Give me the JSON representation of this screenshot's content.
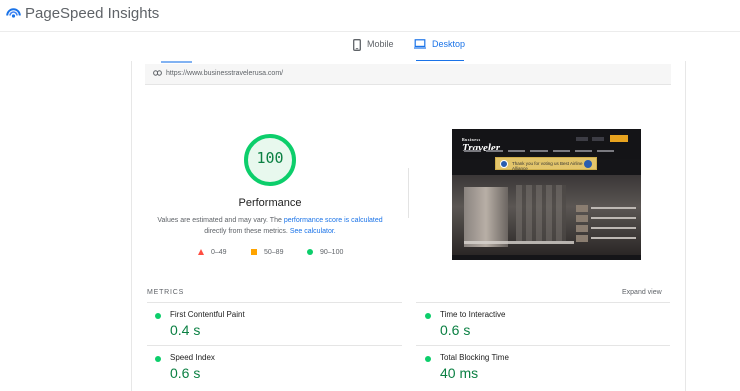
{
  "app": {
    "title": "PageSpeed Insights",
    "brand_color": "#1a73e8"
  },
  "tabs": [
    {
      "label": "Mobile",
      "icon": "smartphone-icon",
      "active": false
    },
    {
      "label": "Desktop",
      "icon": "laptop-icon",
      "active": true
    }
  ],
  "url_bar": {
    "icon": "link-icon",
    "url": "https://www.businesstravelerusa.com/"
  },
  "performance": {
    "score": "100",
    "score_fraction": 1.0,
    "score_color": "#0cce6b",
    "title": "Performance",
    "desc_prefix": "Values are estimated and may vary. The ",
    "desc_link1": "performance score is calculated",
    "desc_middle": " directly from these metrics. ",
    "desc_link2": "See calculator.",
    "legend": [
      {
        "range": "0–49",
        "shape": "triangle",
        "color": "#ff4e42"
      },
      {
        "range": "50–89",
        "shape": "square",
        "color": "#ffa400"
      },
      {
        "range": "90–100",
        "shape": "circle",
        "color": "#0cce6b"
      }
    ]
  },
  "screenshot": {
    "wordmark_small": "Business",
    "wordmark": "Traveler",
    "banner_text": "Thank you for voting us Best Airline Alliance"
  },
  "metrics": {
    "label": "METRICS",
    "expand": "Expand view",
    "items": [
      {
        "name": "First Contentful Paint",
        "value": "0.4 s"
      },
      {
        "name": "Time to Interactive",
        "value": "0.6 s"
      },
      {
        "name": "Speed Index",
        "value": "0.6 s"
      },
      {
        "name": "Total Blocking Time",
        "value": "40 ms"
      }
    ]
  }
}
